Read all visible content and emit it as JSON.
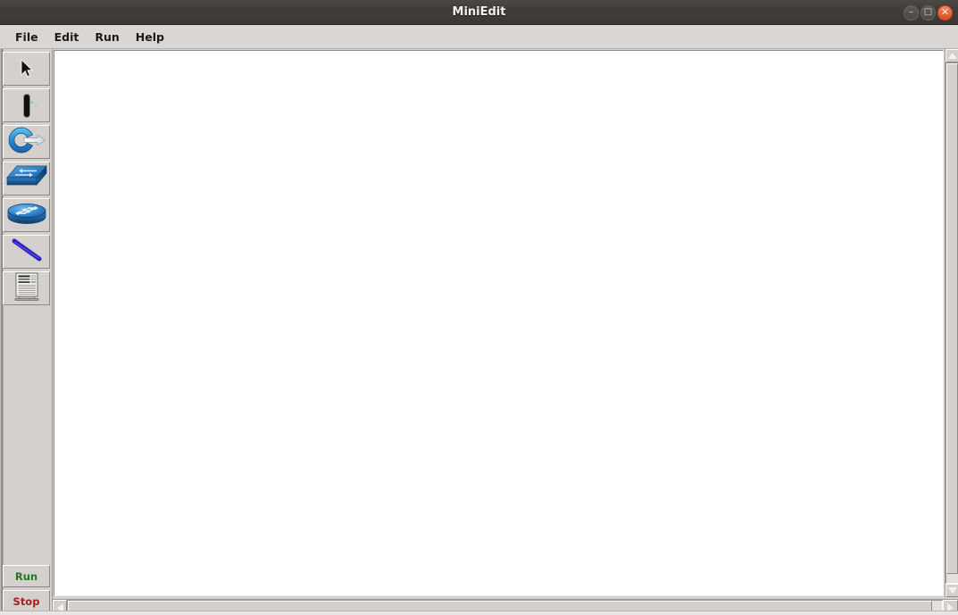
{
  "window": {
    "title": "MiniEdit",
    "controls": [
      {
        "name": "minimize",
        "glyph": "–"
      },
      {
        "name": "maximize",
        "glyph": "□"
      },
      {
        "name": "close",
        "glyph": "✕"
      }
    ]
  },
  "menubar": {
    "items": [
      {
        "label": "File"
      },
      {
        "label": "Edit"
      },
      {
        "label": "Run"
      },
      {
        "label": "Help"
      }
    ]
  },
  "toolbar": {
    "tools": [
      {
        "icon": "select-cursor-icon",
        "label": "Select"
      },
      {
        "icon": "host-icon",
        "label": "Host"
      },
      {
        "icon": "legacy-router-icon",
        "label": "LegacyRouter"
      },
      {
        "icon": "legacy-switch-icon",
        "label": "LegacySwitch"
      },
      {
        "icon": "switch-icon",
        "label": "Switch"
      },
      {
        "icon": "link-icon",
        "label": "Link"
      },
      {
        "icon": "controller-icon",
        "label": "Controller"
      }
    ],
    "run_label": "Run",
    "stop_label": "Stop",
    "run_color": "#1f7a1f",
    "stop_color": "#a32020"
  },
  "canvas": {
    "nodes": [],
    "links": [],
    "background": "#ffffff"
  },
  "scrollbars": {
    "vertical": {
      "up_glyph": "▲",
      "down_glyph": "▼",
      "position": 0
    },
    "horizontal": {
      "left_glyph": "◀",
      "right_glyph": "▶",
      "position": 0
    }
  },
  "colors": {
    "titlebar": "#3d3936",
    "menubar": "#d9d6d3",
    "chrome": "#d4d0cd",
    "accent_blue": "#1f6fc4",
    "terminal_green": "#2ecc40"
  }
}
